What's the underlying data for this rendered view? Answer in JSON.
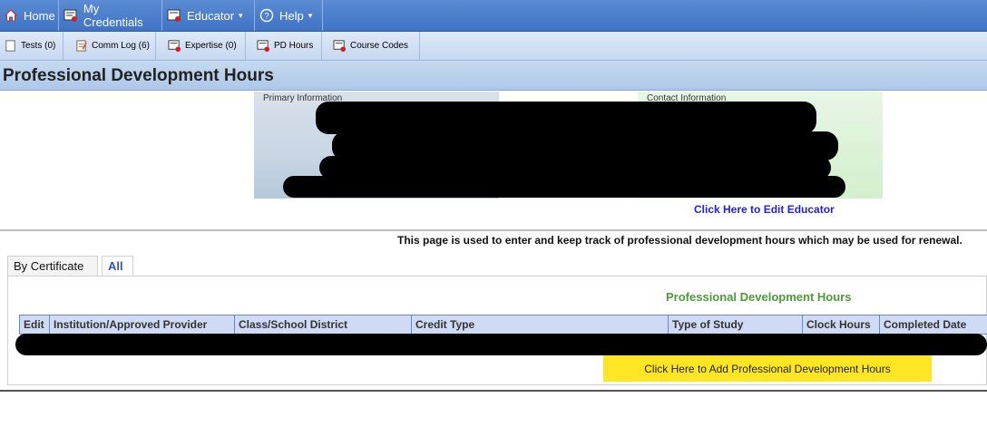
{
  "nav": {
    "home": "Home",
    "credentials": "My Credentials",
    "educator": "Educator",
    "help": "Help"
  },
  "subnav": {
    "tests": "Tests (0)",
    "comm_log": "Comm Log (6)",
    "expertise": "Expertise (0)",
    "pd_hours": "PD Hours",
    "course_codes": "Course Codes"
  },
  "page": {
    "title": "Professional Development Hours",
    "primary_info_title": "Primary Information",
    "contact_info_title": "Contact Information",
    "edit_link": "Click Here to Edit Educator",
    "info_text": "This page is used to enter and keep track of professional development hours which may be used for renewal."
  },
  "tabs": {
    "by_certificate": "By Certificate",
    "all": "All"
  },
  "section": {
    "heading": "Professional Development Hours"
  },
  "table": {
    "columns": [
      "Edit",
      "Institution/Approved Provider",
      "Class/School District",
      "Credit Type",
      "Type of Study",
      "Clock Hours",
      "Completed Date"
    ]
  },
  "actions": {
    "add_button": "Click Here to Add Professional Development Hours"
  },
  "colors": {
    "nav_blue": "#4a7fcc",
    "add_button_yellow": "#ffe625",
    "section_green": "#4d9a3a",
    "link_blue": "#2222dd"
  }
}
